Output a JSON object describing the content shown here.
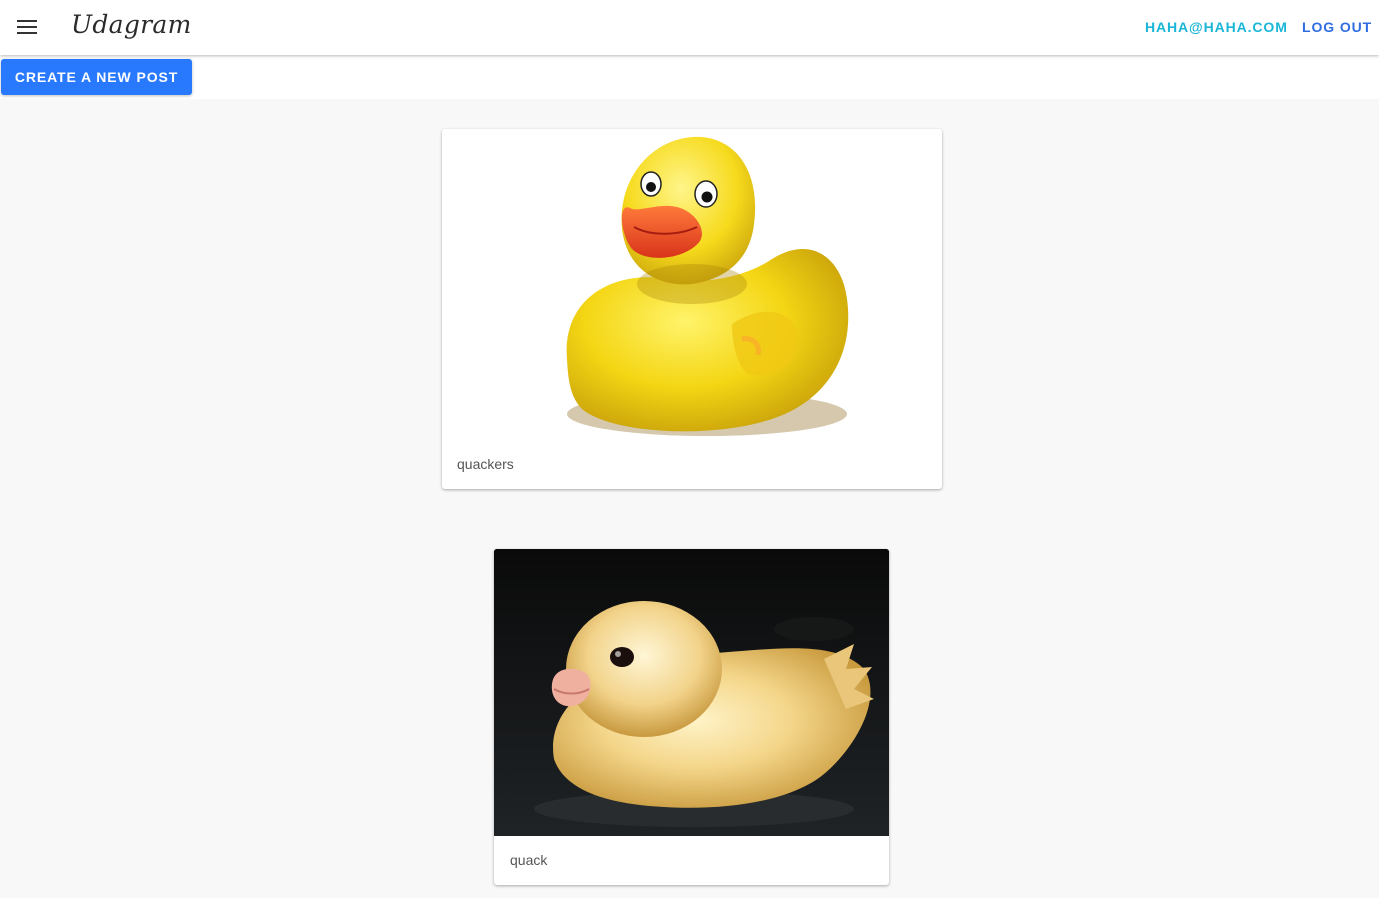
{
  "header": {
    "menu_icon": "menu-icon",
    "brand": "Udagram",
    "user_email": "HAHA@HAHA.COM",
    "logout_label": "LOG OUT"
  },
  "actions": {
    "create_post_label": "CREATE A NEW POST"
  },
  "feed": {
    "posts": [
      {
        "caption": "quackers",
        "image": "rubber-duck-image"
      },
      {
        "caption": "quack",
        "image": "duckling-image"
      }
    ]
  },
  "colors": {
    "accent": "#2979ff",
    "email_link": "#1ab6d6",
    "logout_link": "#2f6de1",
    "toolbar_bg": "#ffffff",
    "content_bg": "#f8f8f8"
  }
}
